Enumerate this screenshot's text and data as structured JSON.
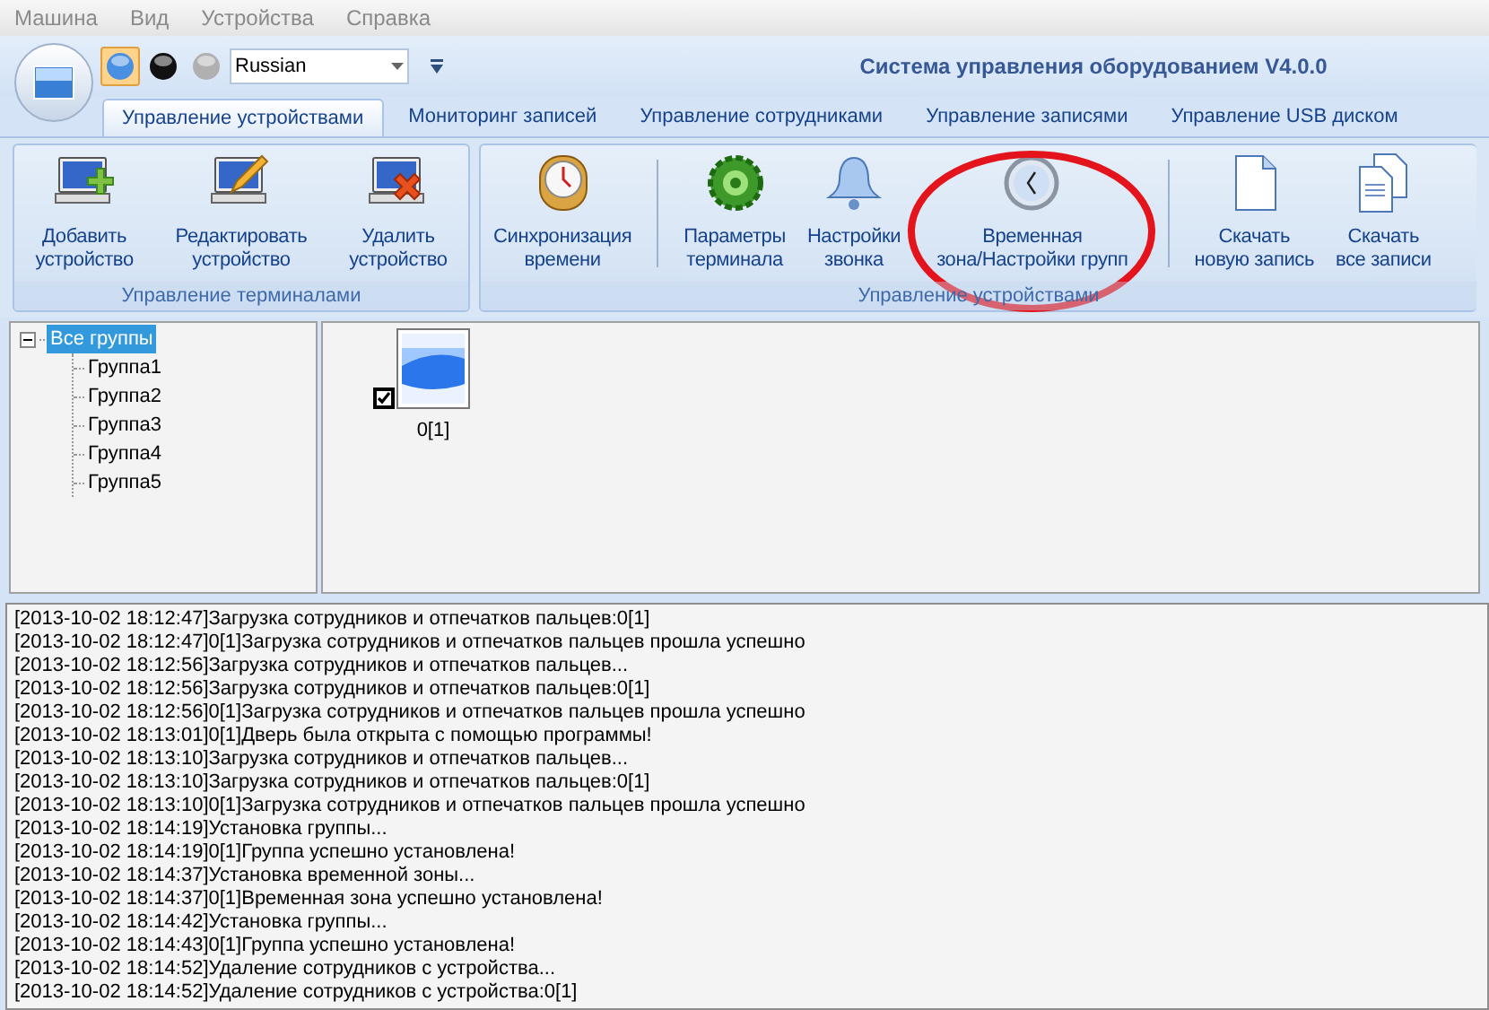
{
  "menu": [
    "Машина",
    "Вид",
    "Устройства",
    "Справка"
  ],
  "style_buttons": [
    {
      "color": "#4a90e2",
      "selected": true
    },
    {
      "color": "#111111",
      "selected": false
    },
    {
      "color": "#b0b0b0",
      "selected": false
    }
  ],
  "language_select": {
    "value": "Russian"
  },
  "window": {
    "title": "Система управления оборудованием V4.0.0"
  },
  "tabs": [
    {
      "label": "Управление устройствами",
      "selected": true
    },
    {
      "label": "Мониторинг записей",
      "selected": false
    },
    {
      "label": "Управление сотрудниками",
      "selected": false
    },
    {
      "label": "Управление записями",
      "selected": false
    },
    {
      "label": "Управление USB диском",
      "selected": false
    }
  ],
  "ribbon": [
    {
      "label": "Управление терминалами",
      "clusters": [
        [
          {
            "label": "Добавить\nустройство"
          },
          {
            "label": "Редактировать\nустройство"
          },
          {
            "label": "Удалить\nустройство"
          }
        ]
      ]
    },
    {
      "label": "Управление устройствами",
      "clusters": [
        [
          {
            "label": "Синхронизация\nвремени"
          }
        ],
        [
          {
            "label": "Параметры\nтерминала"
          },
          {
            "label": "Настройки\nзвонка"
          },
          {
            "label": "Временная\nзона/Настройки групп"
          }
        ],
        [
          {
            "label": "Скачать\nновую запись"
          },
          {
            "label": "Скачать\nвсе записи"
          }
        ]
      ]
    }
  ],
  "tree": {
    "label": "Все группы",
    "selected": true,
    "expanded": true,
    "children": [
      {
        "label": "Группа1",
        "selected": false
      },
      {
        "label": "Группа2",
        "selected": false
      },
      {
        "label": "Группа3",
        "selected": false
      },
      {
        "label": "Группа4",
        "selected": false
      },
      {
        "label": "Группа5",
        "selected": false
      }
    ]
  },
  "devices": [
    {
      "label": "0[1]",
      "checked": true
    }
  ],
  "log": [
    "[2013-10-02 18:12:47]Загрузка сотрудников и отпечатков пальцев:0[1]",
    "[2013-10-02 18:12:47]0[1]Загрузка сотрудников и отпечатков пальцев прошла успешно",
    "[2013-10-02 18:12:56]Загрузка сотрудников и отпечатков пальцев...",
    "[2013-10-02 18:12:56]Загрузка сотрудников и отпечатков пальцев:0[1]",
    "[2013-10-02 18:12:56]0[1]Загрузка сотрудников и отпечатков пальцев прошла успешно",
    "[2013-10-02 18:13:01]0[1]Дверь была открыта с помощью программы!",
    "[2013-10-02 18:13:10]Загрузка сотрудников и отпечатков пальцев...",
    "[2013-10-02 18:13:10]Загрузка сотрудников и отпечатков пальцев:0[1]",
    "[2013-10-02 18:13:10]0[1]Загрузка сотрудников и отпечатков пальцев прошла успешно",
    "[2013-10-02 18:14:19]Установка группы...",
    "[2013-10-02 18:14:19]0[1]Группа успешно установлена!",
    "[2013-10-02 18:14:37]Установка временной зоны...",
    "[2013-10-02 18:14:37]0[1]Временная зона успешно установлена!",
    "[2013-10-02 18:14:42]Установка группы...",
    "[2013-10-02 18:14:43]0[1]Группа успешно установлена!",
    "[2013-10-02 18:14:52]Удаление сотрудников с устройства...",
    "[2013-10-02 18:14:52]Удаление сотрудников с устройства:0[1]"
  ]
}
